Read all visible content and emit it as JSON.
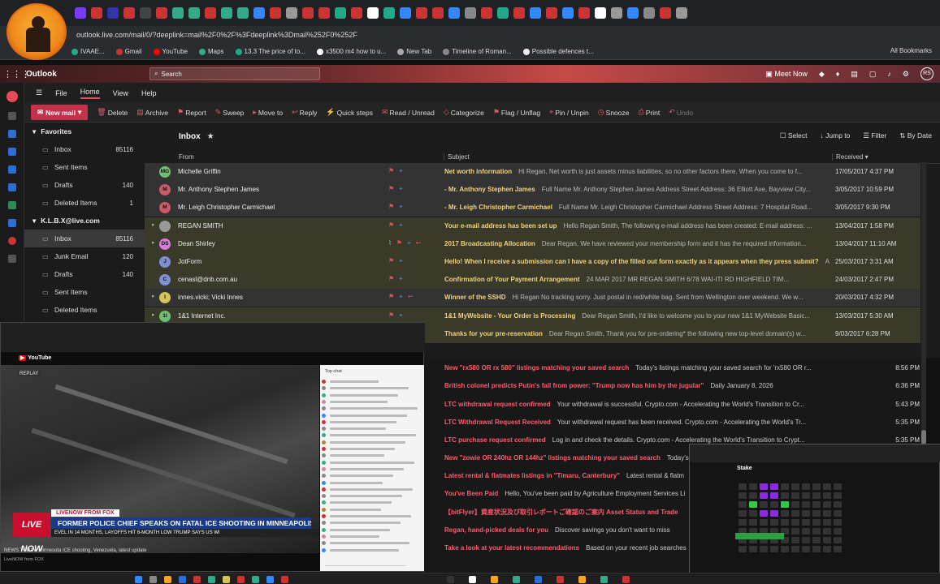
{
  "browser": {
    "address": "outlook.live.com/mail/0/?deeplink=mail%2F0%2F%3Fdeeplink%3Dmail%252F0%252F",
    "tab_colors": [
      "#7a3aff",
      "#c33",
      "#33a",
      "#c33",
      "#444",
      "#c33",
      "#3a8",
      "#3a8",
      "#c33",
      "#3a8",
      "#3a8",
      "#38f",
      "#c33",
      "#999",
      "#c33",
      "#c33",
      "#2a8",
      "#c33",
      "#fff",
      "#2a8",
      "#38f",
      "#c33",
      "#c33",
      "#38f",
      "#888",
      "#c33",
      "#2a8",
      "#c33",
      "#38f",
      "#c33",
      "#38f",
      "#c33",
      "#fff",
      "#999",
      "#38f",
      "#888",
      "#c33",
      "#999"
    ],
    "bookmarks": [
      {
        "label": "IVAAE...",
        "color": "#2a8"
      },
      {
        "label": "Gmail",
        "color": "#c33"
      },
      {
        "label": "YouTube",
        "color": "#f00"
      },
      {
        "label": "Maps",
        "color": "#3a8"
      },
      {
        "label": "13.3 The price of to...",
        "color": "#2a8"
      },
      {
        "label": "x3500 m4 how to u...",
        "color": "#fff"
      },
      {
        "label": "New Tab",
        "color": "#aaa"
      },
      {
        "label": "Timeline of Roman...",
        "color": "#888"
      },
      {
        "label": "Possible defences t...",
        "color": "#eee"
      }
    ],
    "all_bookmarks": "All Bookmarks"
  },
  "outlook": {
    "app_grid": "⋮⋮⋮",
    "app_name": "Outlook",
    "search_placeholder": "Search",
    "meet_now": "Meet Now",
    "user_initials": "RS",
    "menu_tabs": [
      "File",
      "Home",
      "View",
      "Help"
    ],
    "active_tab": "Home",
    "ribbon": {
      "new_mail": "New mail",
      "items": [
        "Delete",
        "Archive",
        "Report",
        "Sweep",
        "Move to",
        "Reply",
        "Quick steps",
        "Read / Unread",
        "Categorize",
        "Flag / Unflag",
        "Pin / Unpin",
        "Snooze",
        "Print",
        "Undo"
      ]
    },
    "folders": {
      "favorites_label": "Favorites",
      "favorites": [
        {
          "name": "Inbox",
          "count": "85116"
        },
        {
          "name": "Sent Items",
          "count": ""
        },
        {
          "name": "Drafts",
          "count": "140"
        },
        {
          "name": "Deleted Items",
          "count": "1"
        }
      ],
      "account_label": "K.L.B.X@live.com",
      "account": [
        {
          "name": "Inbox",
          "count": "85116"
        },
        {
          "name": "Junk Email",
          "count": "120"
        },
        {
          "name": "Drafts",
          "count": "140"
        },
        {
          "name": "Sent Items",
          "count": ""
        },
        {
          "name": "Deleted Items",
          "count": ""
        }
      ]
    },
    "inbox": {
      "title": "Inbox",
      "tools": [
        "Select",
        "Jump to",
        "Filter",
        "By Date"
      ],
      "col_from": "From",
      "col_subject": "Subject",
      "col_received": "Received"
    },
    "messages": [
      {
        "initials": "MG",
        "avatar_color": "#6fbf73",
        "from": "Michelle Griffin",
        "subject": "Net worth information",
        "preview": "Hi Regan, Net worth is just assets minus liabilities, so no other factors there. When you come to f...",
        "date": "17/05/2017 4:37 PM",
        "style": "hl2"
      },
      {
        "initials": "M",
        "avatar_color": "#c85a6a",
        "from": "Mr. Anthony Stephen James",
        "subject": "- Mr. Anthony Stephen James",
        "preview": "Full Name Mr. Anthony Stephen James Address Street Address: 36 Elliott Ave, Bayview City...",
        "date": "3/05/2017 10:59 PM",
        "style": "hl2"
      },
      {
        "initials": "M",
        "avatar_color": "#c85a6a",
        "from": "Mr. Leigh Christopher Carmichael",
        "subject": "- Mr. Leigh Christopher Carmichael",
        "preview": "Full Name Mr. Leigh Christopher Carmichael Address Street Address: 7 Hospital Road...",
        "date": "3/05/2017 9:30 PM",
        "style": "hl2"
      },
      {
        "initials": "",
        "avatar_color": "#999",
        "from": "REGAN SMITH",
        "subject": "Your e-mail address has been set up",
        "preview": "Hello Regan Smith, The following e-mail address has been created: E-mail address: ...",
        "date": "13/04/2017 1:58 PM",
        "style": "hl"
      },
      {
        "initials": "DS",
        "avatar_color": "#d47fd4",
        "from": "Dean Shirley",
        "subject": "2017 Broadcasting Allocation",
        "preview": "Dear Regan, We have reviewed your membership form and it has the required information...",
        "date": "13/04/2017 11:10 AM",
        "style": "hl"
      },
      {
        "initials": "J",
        "avatar_color": "#7f8fd4",
        "from": "JotForm",
        "subject": "Hello! When I receive a submission can I have a copy of the filled out form exactly as it appears when they press submit?",
        "preview": "A",
        "date": "25/03/2017 3:31 AM",
        "style": "hl"
      },
      {
        "initials": "C",
        "avatar_color": "#7f8fd4",
        "from": "cenasl@dnb.com.au",
        "subject": "Confirmation of Your Payment Arrangement",
        "preview": "24 MAR 2017 MR REGAN SMITH 6/78 WAI-ITI RD HIGHFIELD TIM...",
        "date": "24/03/2017 2:47 PM",
        "style": "hl"
      },
      {
        "initials": "I",
        "avatar_color": "#d4c35a",
        "from": "innes.vicki; Vicki Innes",
        "subject": "Winner of the SSHD",
        "preview": "Hi Regan No tracking sorry. Just postal in red/white bag. Sent from Wellington over weekend. We w...",
        "date": "20/03/2017 4:32 PM",
        "style": "hl2"
      },
      {
        "initials": "1I",
        "avatar_color": "#6fbf73",
        "from": "1&1 Internet Inc.",
        "subject": "1&1 MyWebsite - Your Order is Processing",
        "preview": "Dear Regan Smith, I'd like to welcome you to your new 1&1 MyWebsite Basic...",
        "date": "13/03/2017 5:30 AM",
        "style": "hl"
      },
      {
        "initials": "",
        "avatar_color": "",
        "from": "",
        "subject": "Thanks for your pre-reservation",
        "preview": "Dear Regan Smith, Thank you for pre-ordering* the following new top-level domain(s) w...",
        "date": "9/03/2017 6:28 PM",
        "style": "hl"
      }
    ],
    "lower_messages": [
      {
        "subject": "New \"rx580 OR rx 580\" listings matching your saved search",
        "preview": "Today's listings matching your saved search for 'rx580 OR r...",
        "date": "8:56 PM"
      },
      {
        "subject": "British colonel predicts Putin's fall from power: \"Trump now has him by the jugular\"",
        "preview": "Daily January 8, 2026",
        "date": "6:36 PM"
      },
      {
        "subject": "LTC withdrawal request confirmed",
        "preview": "Your withdrawal is successful. Crypto.com - Accelerating the World's Transition to Cr...",
        "date": "5:43 PM"
      },
      {
        "subject": "LTC Withdrawal Request Received",
        "preview": "Your withdrawal request has been received. Crypto.com - Accelerating the World's Tr...",
        "date": "5:35 PM"
      },
      {
        "subject": "LTC purchase request confirmed",
        "preview": "Log in and check the details. Crypto.com - Accelerating the World's Transition to Crypt...",
        "date": "5:35 PM"
      },
      {
        "subject": "New \"zowie OR 240hz OR 144hz\" listings matching your saved search",
        "preview": "Today's",
        "date": ""
      },
      {
        "subject": "Latest rental & flatmates listings in \"Timaru, Canterbury\"",
        "preview": "Latest rental & flatm",
        "date": ""
      },
      {
        "subject": "You've Been Paid",
        "preview": "Hello, You've been paid by Agriculture Employment Services Li",
        "date": ""
      },
      {
        "subject": "【bitFlyer】資産状況及び取引レポートご確認のご案内 Asset Status and Trade",
        "preview": "",
        "date": ""
      },
      {
        "subject": "Regan, hand-picked deals for you",
        "preview": "Discover savings you don't want to miss",
        "date": ""
      },
      {
        "subject": "Take a look at your latest recommendations",
        "preview": "Based on your recent job searches",
        "date": ""
      }
    ]
  },
  "youtube": {
    "replay": "REPLAY",
    "live_now": "LIVE NOW",
    "label": "LIVENOW FROM FOX",
    "headline": "FORMER POLICE CHIEF SPEAKS ON FATAL ICE SHOOTING IN MINNEAPOLIS",
    "ticker": "EVEL IN 14 MONTHS, LAYOFFS HIT 6-MONTH LOW  TRUMP SAYS US WI",
    "video_title": "NEWS TODAY: Minnesota ICE shooting, Venezuela, latest update",
    "channel": "LiveNOW from FOX",
    "chat_title": "Top chat"
  },
  "trading": {
    "logo": "Stake"
  }
}
